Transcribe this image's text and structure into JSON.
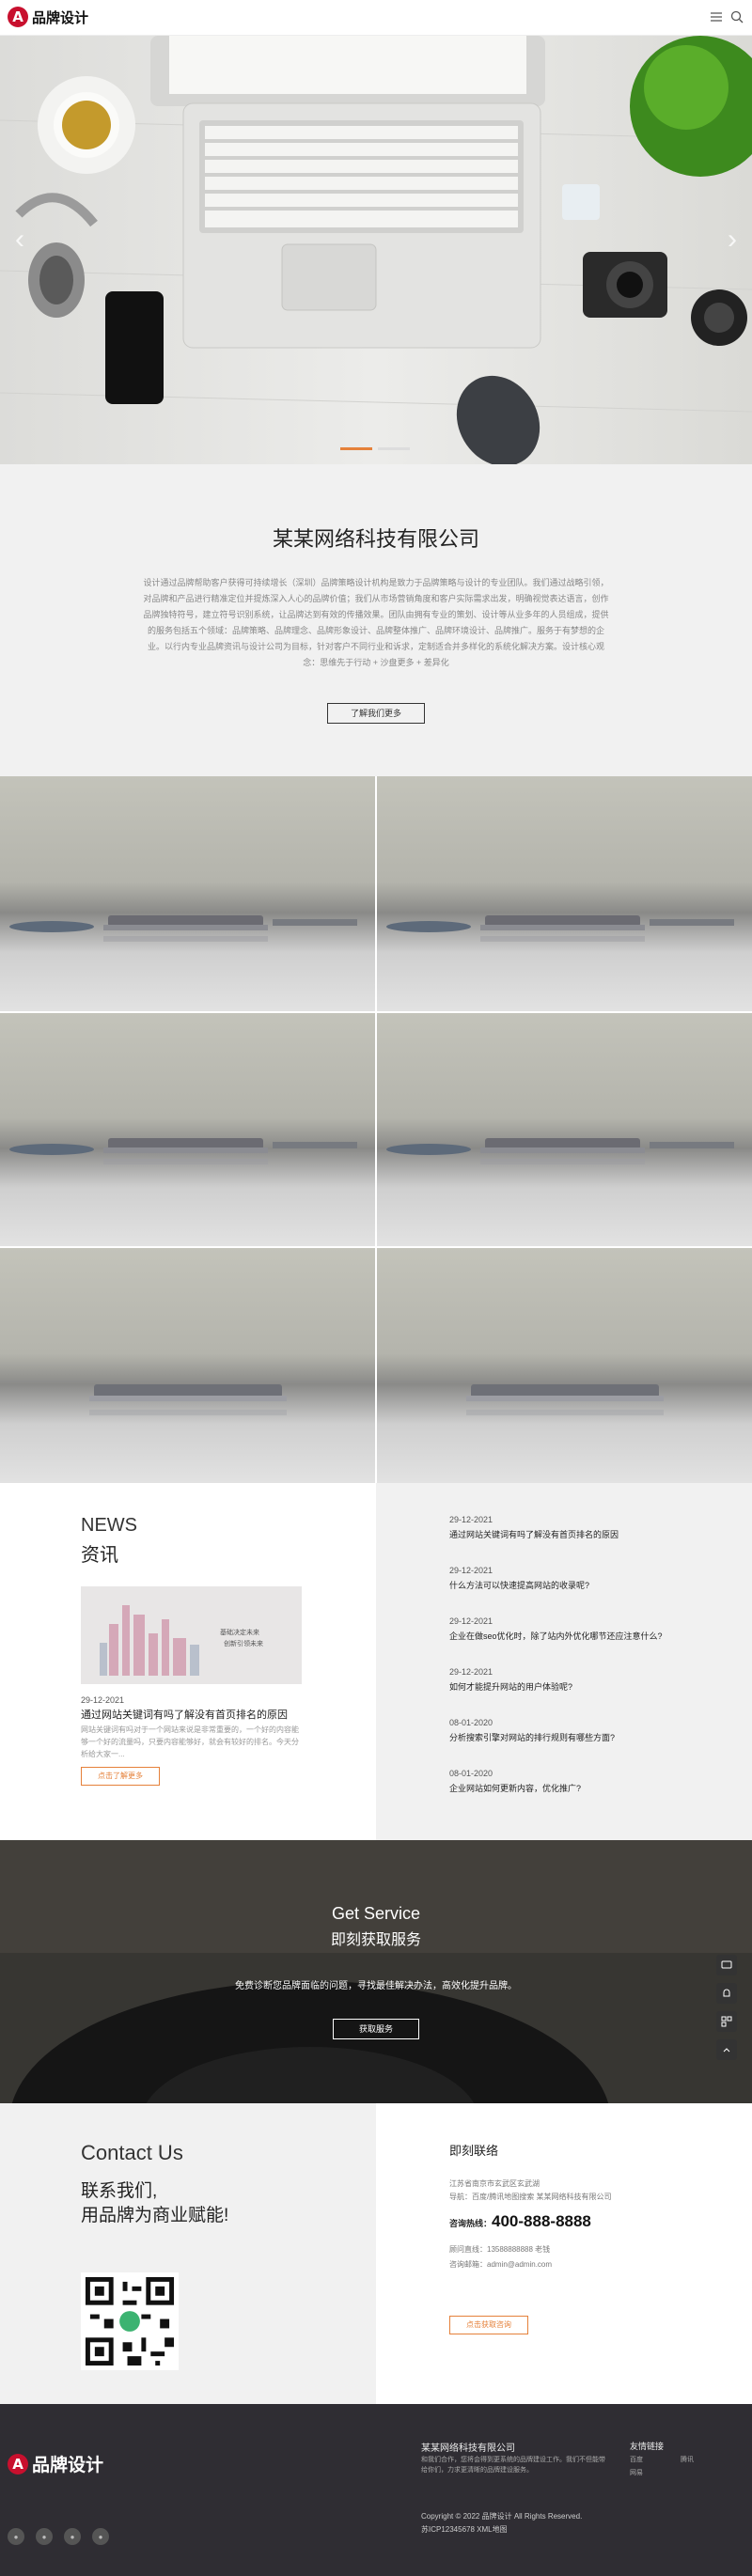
{
  "header": {
    "brand": "品牌设计",
    "logo_letter": "A"
  },
  "hero": {
    "prev": "‹",
    "next": "›",
    "slide_count": 2,
    "active_slide": 1
  },
  "about": {
    "title": "某某网络科技有限公司",
    "description": "设计通过品牌帮助客户获得可持续增长（深圳）品牌策略设计机构是致力于品牌策略与设计的专业团队。我们通过战略引领，对品牌和产品进行精准定位并提炼深入人心的品牌价值；我们从市场营销角度和客户实际需求出发，明确视觉表达语言，创作品牌独特符号，建立符号识别系统，让品牌达到有效的传播效果。团队由拥有专业的策划、设计等从业多年的人员组成，提供的服务包括五个领域：品牌策略、品牌理念、品牌形象设计、品牌整体推广、品牌环境设计、品牌推广。服务于有梦想的企业。以行内专业品牌资讯与设计公司为目标，针对客户不同行业和诉求，定制适合并多样化的系统化解决方案。设计核心观念：思维先于行动 + 沙盘更多 + 差异化",
    "button": "了解我们更多"
  },
  "news": {
    "heading_en": "NEWS",
    "heading_cn": "资讯",
    "thumb_caption_1": "基础决定未来",
    "thumb_caption_2": "创新引领未来",
    "featured": {
      "date": "29-12-2021",
      "title": "通过网站关键词有吗了解没有首页排名的原因",
      "excerpt": "网站关键词有吗对于一个网站来说是非常重要的，一个好的内容能够一个好的流量吗，只要内容能够好，就会有较好的排名。今天分析给大家一..."
    },
    "button": "点击了解更多",
    "items": [
      {
        "date": "29-12-2021",
        "title": "通过网站关键词有吗了解没有首页排名的原因"
      },
      {
        "date": "29-12-2021",
        "title": "什么方法可以快速提高网站的收录呢?"
      },
      {
        "date": "29-12-2021",
        "title": "企业在做seo优化时，除了站内外优化哪节还应注意什么?"
      },
      {
        "date": "29-12-2021",
        "title": "如何才能提升网站的用户体验呢?"
      },
      {
        "date": "08-01-2020",
        "title": "分析搜索引擎对网站的排行规则有哪些方面?"
      },
      {
        "date": "08-01-2020",
        "title": "企业网站如何更新内容，优化推广?"
      }
    ]
  },
  "service": {
    "title_en": "Get Service",
    "title_cn": "即刻获取服务",
    "desc": "免费诊断您品牌面临的问题，寻找最佳解决办法，高效化提升品牌。",
    "button": "获取服务"
  },
  "contact": {
    "title_en": "Contact Us",
    "slogan_1": "联系我们,",
    "slogan_2": "用品牌为商业赋能!",
    "heading": "即刻联络",
    "address": "江苏省南京市玄武区玄武湖",
    "ad_line": "导航：百度/腾讯地图搜索 某某网络科技有限公司",
    "hotline_label": "咨询热线：",
    "hotline": "400-888-8888",
    "mobile": "顾问直线：13588888888 老钱",
    "email": "咨询邮箱：admin@admin.com",
    "button": "点击获取咨询"
  },
  "footer": {
    "brand": "品牌设计",
    "company": "某某网络科技有限公司",
    "company_desc": "和我们合作，您将会得到更系统的品牌建设工作。我们不但能带给你们，力求更清晰的品牌建设服务。",
    "links_title": "友情链接",
    "links": [
      "百度",
      "腾讯",
      "网易"
    ],
    "copyright": "Copyright © 2022 品牌设计 All Rights Reserved.",
    "icp": "苏ICP12345678 XML地图"
  },
  "float_bar": [
    "消息",
    "客服",
    "二维码",
    "返回顶部"
  ],
  "colors": {
    "accent": "#e5813a",
    "brand_red": "#c8102e",
    "dark": "#2f2d33",
    "light_bg": "#f1f1f1"
  }
}
